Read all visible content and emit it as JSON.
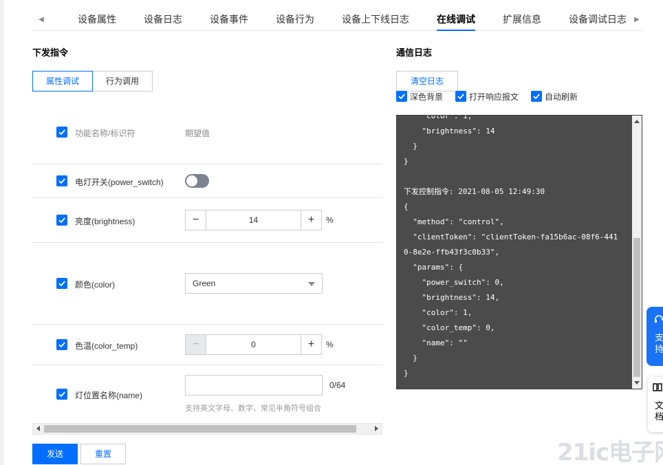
{
  "tabs": [
    {
      "label": "设备属性",
      "active": false
    },
    {
      "label": "设备日志",
      "active": false
    },
    {
      "label": "设备事件",
      "active": false
    },
    {
      "label": "设备行为",
      "active": false
    },
    {
      "label": "设备上下线日志",
      "active": false
    },
    {
      "label": "在线调试",
      "active": true
    },
    {
      "label": "扩展信息",
      "active": false
    },
    {
      "label": "设备调试日志",
      "active": false
    }
  ],
  "left": {
    "title": "下发指令",
    "mode_buttons": [
      "属性调试",
      "行为调用"
    ],
    "header": {
      "name_col": "功能名称/标识符",
      "value_col": "期望值"
    },
    "rows": {
      "power_switch": {
        "label": "电灯开关(power_switch)",
        "on": false
      },
      "brightness": {
        "label": "亮度(brightness)",
        "value": "14",
        "unit": "%"
      },
      "color": {
        "label": "颜色(color)",
        "selected": "Green"
      },
      "color_temp": {
        "label": "色温(color_temp)",
        "value": "0",
        "unit": "%"
      },
      "name": {
        "label": "灯位置名称(name)",
        "value": "",
        "counter": "0/64",
        "hint": "支持英文字母、数字、常见半角符号组合"
      }
    },
    "actions": {
      "send": "发送",
      "reset": "重置"
    }
  },
  "right": {
    "title": "通信日志",
    "clear_button": "清空日志",
    "options": [
      "深色背景",
      "打开响应报文",
      "自动刷新"
    ],
    "log_text": "    \"color\": 1,\n    \"brightness\": 14\n  }\n}\n\n下发控制指令: 2021-08-05 12:49:30\n{\n  \"method\": \"control\",\n  \"clientToken\": \"clientToken-fa15b6ac-08f6-441\n0-8e2e-ffb43f3c0b33\",\n  \"params\": {\n    \"power_switch\": 0,\n    \"brightness\": 14,\n    \"color\": 1,\n    \"color_temp\": 0,\n    \"name\": \"\"\n  }\n}"
  },
  "floating": {
    "support": "支持",
    "doc": "文档"
  },
  "watermark": "21ic电子网",
  "colors": {
    "primary": "#006eff",
    "log_bg": "#4b4b4b",
    "toggle_off": "#7b8390"
  }
}
